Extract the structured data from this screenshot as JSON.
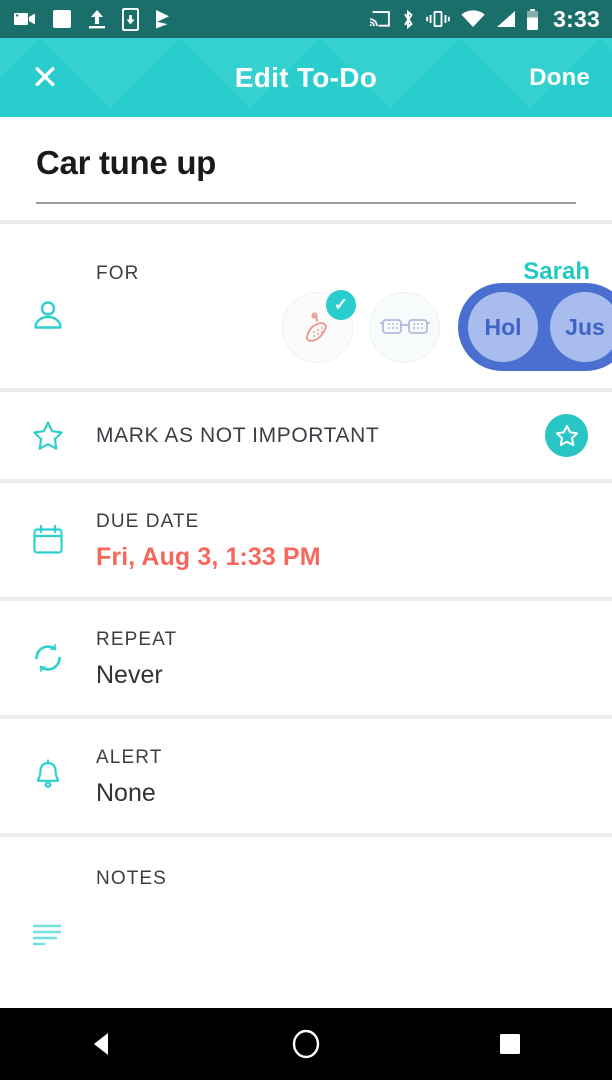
{
  "status_bar": {
    "time": "3:33",
    "left_icons": [
      "video-camera-icon",
      "screenshot-icon",
      "upload-icon",
      "download-to-device-icon",
      "play-store-icon"
    ],
    "right_icons": [
      "cast-icon",
      "bluetooth-icon",
      "vibrate-icon",
      "wifi-icon",
      "cellular-signal-icon",
      "battery-icon"
    ]
  },
  "app_bar": {
    "close_label": "✕",
    "title": "Edit To-Do",
    "done_label": "Done",
    "background_color": "#29cdcd"
  },
  "task": {
    "title": "Car tune up"
  },
  "for_section": {
    "label": "FOR",
    "selected_name": "Sarah",
    "icon": "person-icon",
    "avatars": [
      {
        "name": "watermelon-avatar",
        "selected": true,
        "check": "✓"
      },
      {
        "name": "glasses-avatar",
        "selected": false,
        "check": ""
      }
    ],
    "pill_avatars": [
      {
        "initials": "Hol"
      },
      {
        "initials": "Jus"
      }
    ],
    "accent_color": "#25c9c4",
    "pill_color": "#4a6fd1"
  },
  "important_section": {
    "label": "MARK AS NOT IMPORTANT",
    "icon": "star-outline-icon",
    "toggle_icon": "star-filled-badge-icon",
    "toggle_color": "#2ac5c5"
  },
  "due_date_section": {
    "label": "DUE DATE",
    "value": "Fri, Aug 3, 1:33 PM",
    "icon": "calendar-icon",
    "value_color": "#f4685e"
  },
  "repeat_section": {
    "label": "REPEAT",
    "value": "Never",
    "icon": "repeat-icon"
  },
  "alert_section": {
    "label": "ALERT",
    "value": "None",
    "icon": "bell-icon"
  },
  "notes_section": {
    "label": "NOTES",
    "value": "",
    "icon": "notes-lines-icon"
  },
  "nav_bar": {
    "back": "back-triangle-icon",
    "home": "home-circle-icon",
    "recents": "recents-square-icon"
  }
}
